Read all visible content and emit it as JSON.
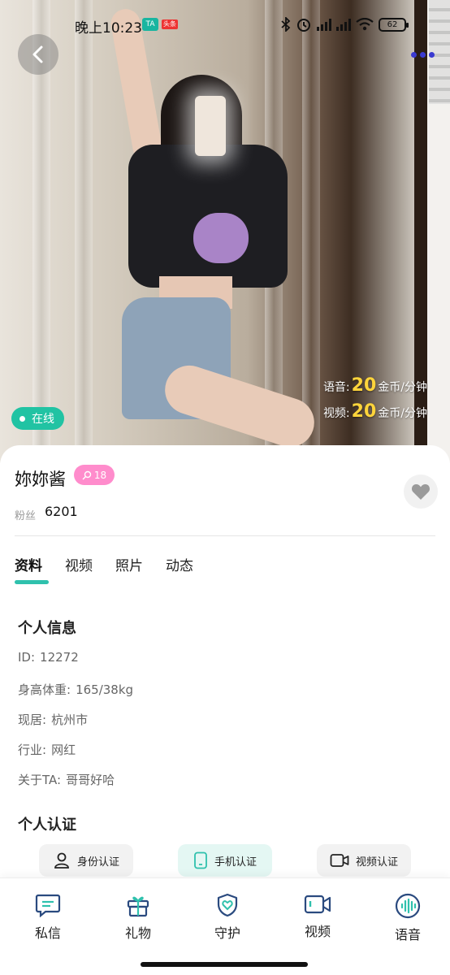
{
  "status_bar": {
    "time": "晚上10:23",
    "app_badge_1": "TA",
    "app_badge_2": "头条",
    "battery": "62"
  },
  "hero": {
    "price_voice": {
      "label": "语音:",
      "value": "20",
      "unit": "金币/分钟"
    },
    "price_video": {
      "label": "视频:",
      "value": "20",
      "unit": "金币/分钟"
    },
    "online_status": "在线"
  },
  "profile": {
    "name": "妳妳酱",
    "level": "18",
    "fans_label": "粉丝",
    "fans_count": "6201"
  },
  "tabs": [
    {
      "label": "资料",
      "active": true
    },
    {
      "label": "视频",
      "active": false
    },
    {
      "label": "照片",
      "active": false
    },
    {
      "label": "动态",
      "active": false
    }
  ],
  "personal_info": {
    "title": "个人信息",
    "rows": [
      {
        "label": "ID:",
        "value": "12272"
      },
      {
        "label": "身高体重:",
        "value": "165/38kg"
      },
      {
        "label": "现居:",
        "value": "杭州市"
      },
      {
        "label": "行业:",
        "value": "网红"
      },
      {
        "label": "关于TA:",
        "value": "哥哥好哈"
      }
    ]
  },
  "verification": {
    "title": "个人认证",
    "items": [
      {
        "label": "身份认证",
        "icon": "person-icon"
      },
      {
        "label": "手机认证",
        "icon": "phone-icon"
      },
      {
        "label": "视频认证",
        "icon": "video-icon"
      }
    ]
  },
  "bottom_nav": [
    {
      "label": "私信",
      "icon": "message-icon"
    },
    {
      "label": "礼物",
      "icon": "gift-icon"
    },
    {
      "label": "守护",
      "icon": "guard-shield-icon"
    },
    {
      "label": "视频",
      "icon": "video-call-icon"
    },
    {
      "label": "语音",
      "icon": "voice-call-icon"
    }
  ],
  "colors": {
    "accent": "#2fc1ad",
    "online": "#21c3a3",
    "price": "#ffd43b",
    "level_badge": "#ff8ccc"
  }
}
